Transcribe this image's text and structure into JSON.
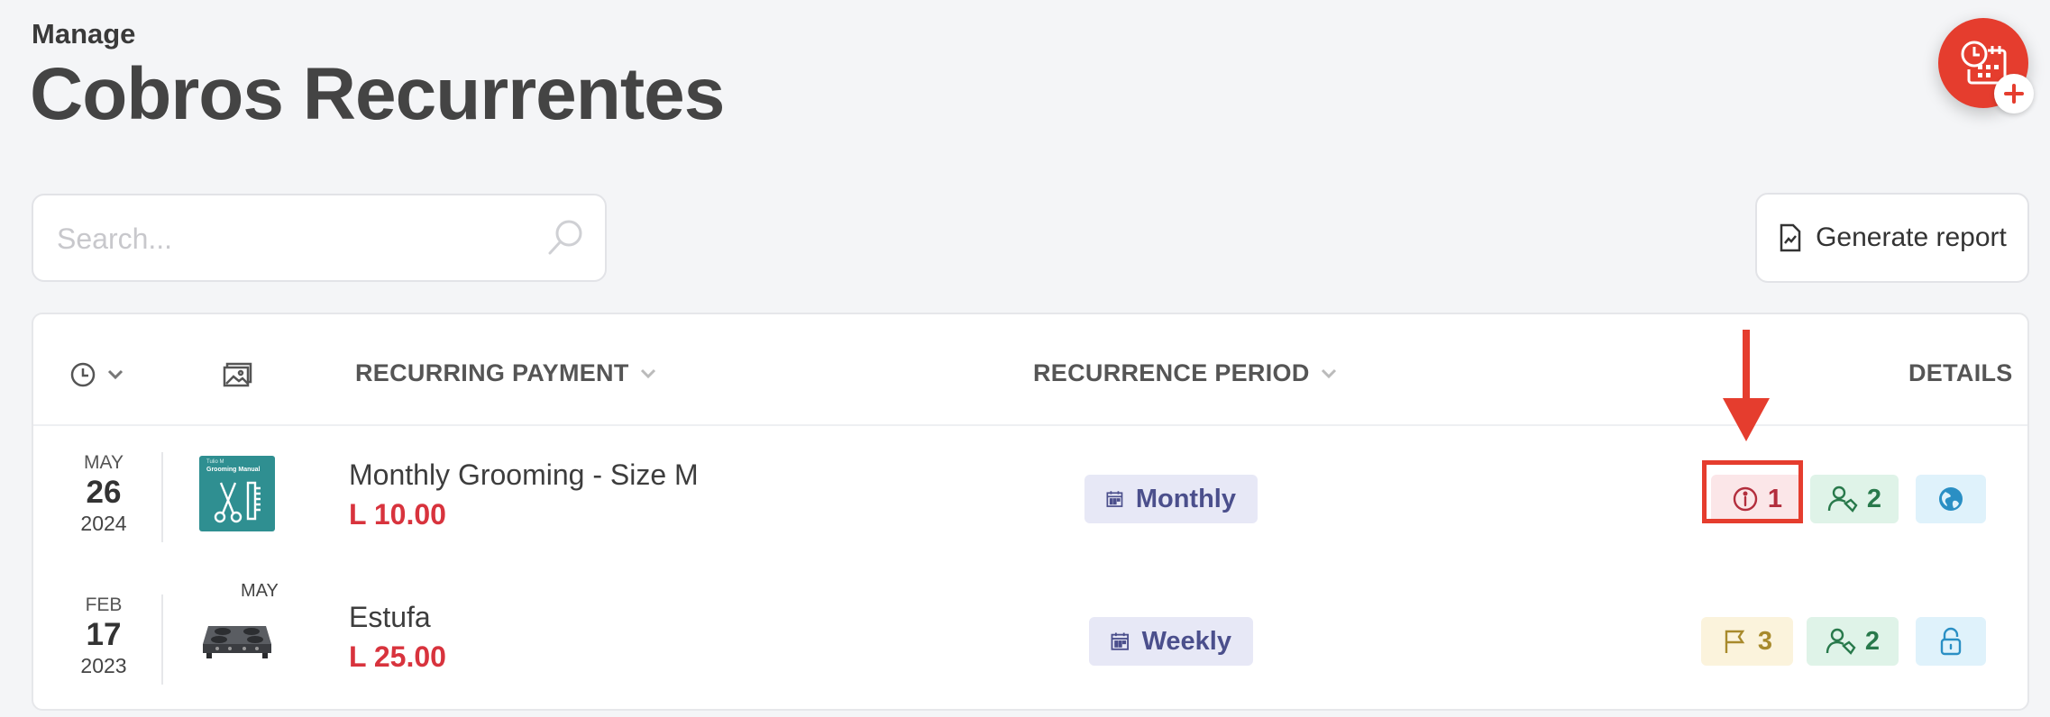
{
  "header": {
    "eyebrow": "Manage",
    "title": "Cobros Recurrentes"
  },
  "fab": {
    "icon": "calendar-clock-add-icon",
    "color": "#e53d2e"
  },
  "search": {
    "placeholder": "Search...",
    "value": ""
  },
  "toolbar": {
    "report_label": "Generate report"
  },
  "table": {
    "columns": {
      "payment": "RECURRING PAYMENT",
      "period": "RECURRENCE PERIOD",
      "details": "DETAILS"
    },
    "rows": [
      {
        "month": "MAY",
        "day": "26",
        "year": "2024",
        "thumb_title": "Tulio M",
        "thumb_subtitle": "Grooming Manual",
        "name": "Monthly Grooming - Size M",
        "price": "L 10.00",
        "period": "Monthly",
        "badges": [
          {
            "icon": "info-icon",
            "count": "1",
            "style": "red"
          },
          {
            "icon": "user-tag-icon",
            "count": "2",
            "style": "green"
          },
          {
            "icon": "globe-icon",
            "count": "",
            "style": "blue"
          }
        ]
      },
      {
        "month": "FEB",
        "day": "17",
        "year": "2023",
        "thumb_label": "MAY",
        "name": "Estufa",
        "price": "L 25.00",
        "period": "Weekly",
        "badges": [
          {
            "icon": "flag-icon",
            "count": "3",
            "style": "yellow"
          },
          {
            "icon": "user-tag-icon",
            "count": "2",
            "style": "green"
          },
          {
            "icon": "lock-icon",
            "count": "",
            "style": "blue"
          }
        ]
      }
    ]
  },
  "annotation_color": "#e53d2e"
}
